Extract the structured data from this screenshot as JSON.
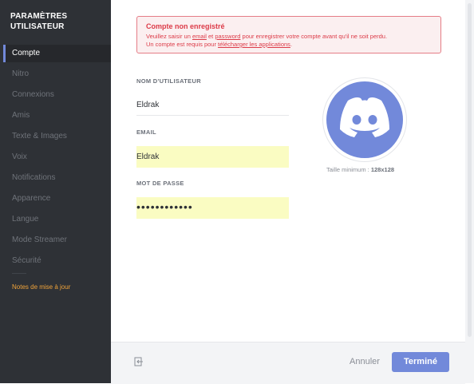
{
  "sidebar": {
    "title_line1": "PARAMÈTRES",
    "title_line2": "UTILISATEUR",
    "items": [
      {
        "label": "Compte",
        "active": true
      },
      {
        "label": "Nitro"
      },
      {
        "label": "Connexions"
      },
      {
        "label": "Amis"
      },
      {
        "label": "Texte & Images"
      },
      {
        "label": "Voix"
      },
      {
        "label": "Notifications"
      },
      {
        "label": "Apparence"
      },
      {
        "label": "Langue"
      },
      {
        "label": "Mode Streamer"
      },
      {
        "label": "Sécurité"
      }
    ],
    "notes_label": "Notes de mise à jour"
  },
  "alert": {
    "title": "Compte non enregistré",
    "line1_pre": "Veuillez saisir un ",
    "line1_link1": "email",
    "line1_mid": " et ",
    "line1_link2": "password",
    "line1_post": " pour enregistrer votre compte avant qu'il ne soit perdu.",
    "line2_pre": "Un compte est requis pour ",
    "line2_link": "télécharger les applications",
    "line2_post": "."
  },
  "form": {
    "username_label": "NOM D'UTILISATEUR",
    "username_value": "Eldrak",
    "email_label": "EMAIL",
    "email_value": "Eldrak",
    "password_label": "MOT DE PASSE",
    "password_value": "••••••••••••"
  },
  "avatar": {
    "min_size_label": "Taille minimum : ",
    "min_size_value": "128x128",
    "icon": "discord-logo-icon"
  },
  "footer": {
    "cancel_label": "Annuler",
    "done_label": "Terminé",
    "logout_icon": "logout-icon"
  },
  "colors": {
    "sidebar_bg": "#2e3136",
    "accent": "#7289da",
    "alert_red": "#dc3b48",
    "notes_orange": "#f0a33a",
    "autofill_yellow": "#fafcc2"
  }
}
